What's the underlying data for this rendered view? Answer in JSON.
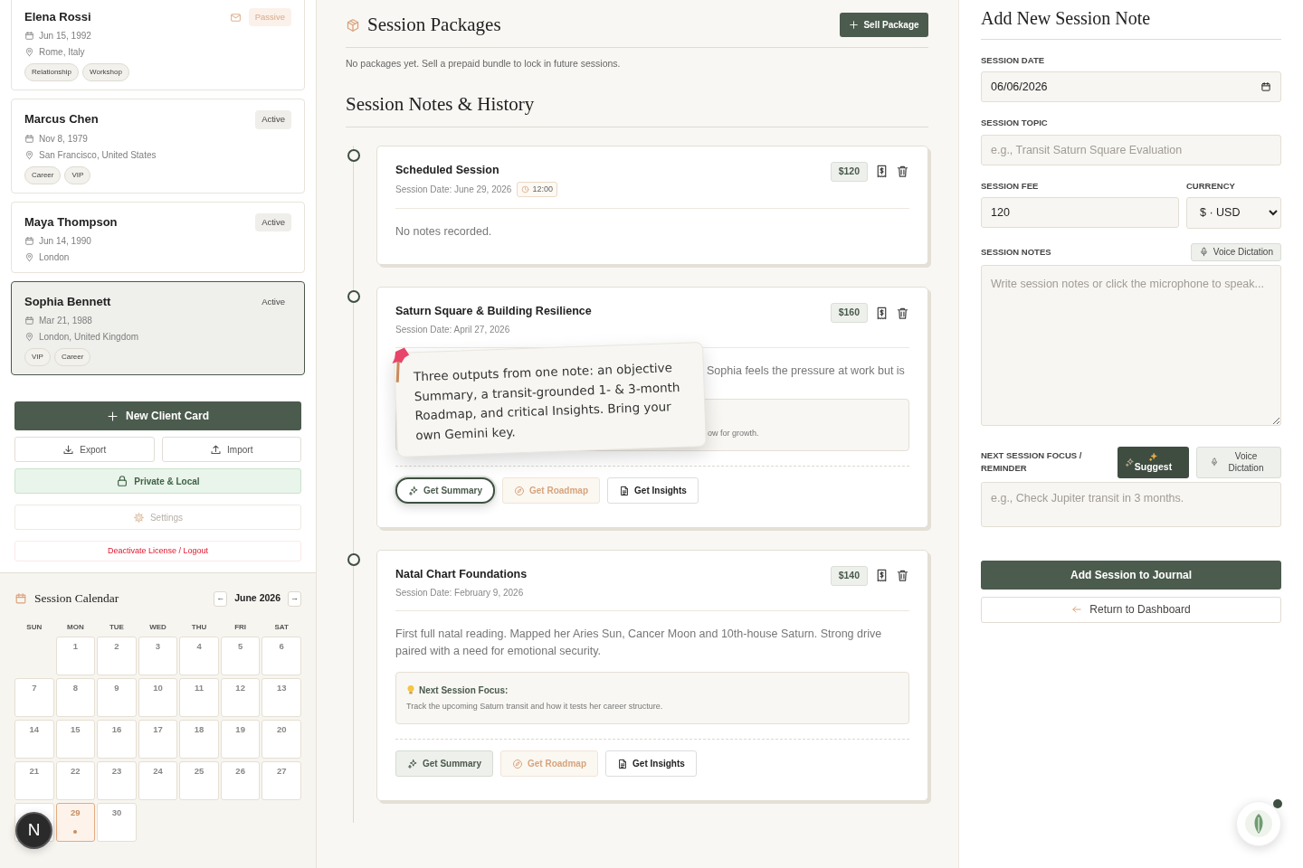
{
  "clients": [
    {
      "name": "Elena Rossi",
      "status": "Passive",
      "status_muted": true,
      "email": true,
      "birth_date": "Jun 15, 1992",
      "place": "Rome, Italy",
      "tags": [
        "Relationship",
        "Workshop"
      ],
      "selected": false
    },
    {
      "name": "Marcus Chen",
      "status": "Active",
      "status_muted": false,
      "email": false,
      "birth_date": "Nov 8, 1979",
      "place": "San Francisco, United States",
      "tags": [
        "Career",
        "VIP"
      ],
      "selected": false
    },
    {
      "name": "Maya Thompson",
      "status": "Active",
      "status_muted": false,
      "email": false,
      "birth_date": "Jun 14, 1990",
      "place": "London",
      "selected": false
    },
    {
      "name": "Sophia Bennett",
      "status": "Active",
      "status_muted": false,
      "email": false,
      "birth_date": "Mar 21, 1988",
      "place": "London, United Kingdom",
      "tags": [
        "VIP",
        "Career"
      ],
      "selected": true
    }
  ],
  "sidebar_actions": {
    "new_client": "New Client Card",
    "export": "Export",
    "import": "Import",
    "privacy": "Private & Local",
    "settings": "Settings",
    "logout": "Deactivate License / Logout"
  },
  "calendar": {
    "title": "Session Calendar",
    "prev": "←",
    "month": "June 2026",
    "next": "→",
    "weekdays": [
      "SUN",
      "MON",
      "TUE",
      "WED",
      "THU",
      "FRI",
      "SAT"
    ],
    "days": [
      {
        "kind": "blank"
      },
      {
        "kind": "day",
        "label": "1",
        "selected": false,
        "session": false
      },
      {
        "kind": "day",
        "label": "2",
        "selected": false,
        "session": false
      },
      {
        "kind": "day",
        "label": "3",
        "selected": false,
        "session": false
      },
      {
        "kind": "day",
        "label": "4",
        "selected": false,
        "session": false
      },
      {
        "kind": "day",
        "label": "5",
        "selected": false,
        "session": false
      },
      {
        "kind": "day",
        "label": "6",
        "selected": false,
        "session": false
      },
      {
        "kind": "day",
        "label": "7",
        "selected": false,
        "session": false
      },
      {
        "kind": "day",
        "label": "8",
        "selected": false,
        "session": false
      },
      {
        "kind": "day",
        "label": "9",
        "selected": false,
        "session": false
      },
      {
        "kind": "day",
        "label": "10",
        "selected": false,
        "session": false
      },
      {
        "kind": "day",
        "label": "11",
        "selected": false,
        "session": false
      },
      {
        "kind": "day",
        "label": "12",
        "selected": false,
        "session": false
      },
      {
        "kind": "day",
        "label": "13",
        "selected": false,
        "session": false
      },
      {
        "kind": "day",
        "label": "14",
        "selected": false,
        "session": false
      },
      {
        "kind": "day",
        "label": "15",
        "selected": false,
        "session": false
      },
      {
        "kind": "day",
        "label": "16",
        "selected": false,
        "session": false
      },
      {
        "kind": "day",
        "label": "17",
        "selected": false,
        "session": false
      },
      {
        "kind": "day",
        "label": "18",
        "selected": false,
        "session": false
      },
      {
        "kind": "day",
        "label": "19",
        "selected": false,
        "session": false
      },
      {
        "kind": "day",
        "label": "20",
        "selected": false,
        "session": false
      },
      {
        "kind": "day",
        "label": "21",
        "selected": false,
        "session": false
      },
      {
        "kind": "day",
        "label": "22",
        "selected": false,
        "session": false
      },
      {
        "kind": "day",
        "label": "23",
        "selected": false,
        "session": false
      },
      {
        "kind": "day",
        "label": "24",
        "selected": false,
        "session": false
      },
      {
        "kind": "day",
        "label": "25",
        "selected": false,
        "session": false
      },
      {
        "kind": "day",
        "label": "26",
        "selected": false,
        "session": false
      },
      {
        "kind": "day",
        "label": "27",
        "selected": false,
        "session": false
      },
      {
        "kind": "covered"
      },
      {
        "kind": "day",
        "label": "29",
        "selected": true,
        "session": true
      },
      {
        "kind": "day",
        "label": "30",
        "selected": false,
        "session": false
      }
    ]
  },
  "packages": {
    "title": "Session Packages",
    "sell_button": "Sell Package",
    "empty_text": "No packages yet. Sell a prepaid bundle to lock in future sessions."
  },
  "history": {
    "title": "Session Notes & History",
    "sessions": [
      {
        "title": "Scheduled Session",
        "date": "Session Date: June 29, 2026",
        "time": "12:00",
        "fee": "$120",
        "notes": "No notes recorded.",
        "covered": false
      },
      {
        "title": "Saturn Square & Building Resilience",
        "date": "Session Date: April 27, 2026",
        "fee": "$160",
        "notes": "Sophia feels the pressure at work but is",
        "focus": {
          "text": "ow for growth."
        },
        "covered": true,
        "callout": "Three outputs from one note: an objective Summary, a transit-grounded 1- & 3-month Roadmap, and critical Insights. Bring your own Gemini key.",
        "actions": [
          {
            "label": "Get Summary",
            "kind": "summary",
            "focused": true
          },
          {
            "label": "Get Roadmap",
            "kind": "roadmap",
            "focused": false
          },
          {
            "label": "Get Insights",
            "kind": "insights",
            "focused": false
          }
        ]
      },
      {
        "title": "Natal Chart Foundations",
        "date": "Session Date: February 9, 2026",
        "fee": "$140",
        "notes": "First full natal reading. Mapped her Aries Sun, Cancer Moon and 10th-house Saturn. Strong drive paired with a need for emotional security.",
        "focus": {
          "label": "Next Session Focus:",
          "text": "Track the upcoming Saturn transit and how it tests her career structure."
        },
        "covered": false,
        "actions": [
          {
            "label": "Get Summary",
            "kind": "summary",
            "focused": false
          },
          {
            "label": "Get Roadmap",
            "kind": "roadmap",
            "focused": false
          },
          {
            "label": "Get Insights",
            "kind": "insights",
            "focused": false
          }
        ]
      }
    ]
  },
  "form": {
    "title": "Add New Session Note",
    "date": {
      "label": "SESSION DATE",
      "value": "06/06/2026"
    },
    "topic": {
      "label": "SESSION TOPIC",
      "placeholder": "e.g., Transit Saturn Square Evaluation"
    },
    "fee": {
      "label": "SESSION FEE",
      "value": "120"
    },
    "currency": {
      "label": "CURRENCY",
      "value": "$ · USD"
    },
    "notes": {
      "label": "SESSION NOTES",
      "dictation": "Voice Dictation",
      "placeholder": "Write session notes or click the microphone to speak..."
    },
    "focus": {
      "label": "NEXT SESSION FOCUS / REMINDER",
      "suggest": "Suggest",
      "dictation": "Voice Dictation",
      "placeholder": "e.g., Check Jupiter transit in 3 months."
    },
    "submit": "Add Session to Journal",
    "back": "Return to Dashboard"
  },
  "floating": {
    "avatar": "N",
    "assistant_notification": true
  }
}
